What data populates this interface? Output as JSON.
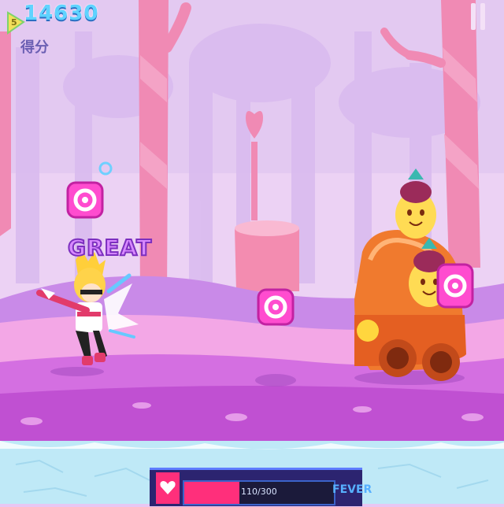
{
  "hud": {
    "score": "14630",
    "score_label": "得分",
    "combo_badge_number": "5"
  },
  "judgement": "GREAT",
  "health": {
    "text": "110/300",
    "fraction": 0.367
  },
  "fever_label": "FEVER",
  "colors": {
    "sky": "#e9c6f2",
    "ground": "#d46fe1",
    "road": "#f7bdf0",
    "water": "#bfe9f7",
    "note": "#ff4ccf",
    "health": "#ff2f7b",
    "fever": "#57b0ff"
  },
  "icons": [
    "combo-badge-icon",
    "pause-icon",
    "heart-icon",
    "note-icon"
  ]
}
